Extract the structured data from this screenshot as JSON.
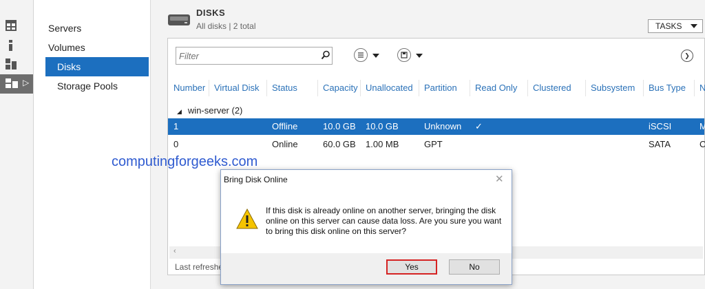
{
  "nav": {
    "items": [
      {
        "label": "Servers"
      },
      {
        "label": "Volumes"
      },
      {
        "label": "Disks"
      },
      {
        "label": "Storage Pools"
      }
    ]
  },
  "header": {
    "title": "DISKS",
    "subtitle": "All disks | 2 total",
    "tasks_label": "TASKS"
  },
  "filter": {
    "placeholder": "Filter"
  },
  "table": {
    "columns": [
      "Number",
      "Virtual Disk",
      "Status",
      "Capacity",
      "Unallocated",
      "Partition",
      "Read Only",
      "Clustered",
      "Subsystem",
      "Bus Type",
      "N"
    ],
    "group_label": "win-server (2)",
    "rows": [
      {
        "number": "1",
        "virtual_disk": "",
        "status": "Offline",
        "capacity": "10.0 GB",
        "unallocated": "10.0 GB",
        "partition": "Unknown",
        "read_only": "✓",
        "clustered": "",
        "subsystem": "",
        "bus_type": "iSCSI",
        "extra": "M"
      },
      {
        "number": "0",
        "virtual_disk": "",
        "status": "Online",
        "capacity": "60.0 GB",
        "unallocated": "1.00 MB",
        "partition": "GPT",
        "read_only": "",
        "clustered": "",
        "subsystem": "",
        "bus_type": "SATA",
        "extra": "C"
      }
    ]
  },
  "footer": {
    "last_refreshed": "Last refreshe"
  },
  "watermark": "computingforgeeks.com",
  "dialog": {
    "title": "Bring Disk Online",
    "message": "If this disk is already online on another server, bringing the disk online on this server can cause data loss. Are you sure you want to bring this disk online on this server?",
    "yes_label": "Yes",
    "no_label": "No"
  },
  "colors": {
    "accent": "#1c6fbf",
    "highlight_border": "#d52222",
    "column_header": "#2a71b8"
  }
}
